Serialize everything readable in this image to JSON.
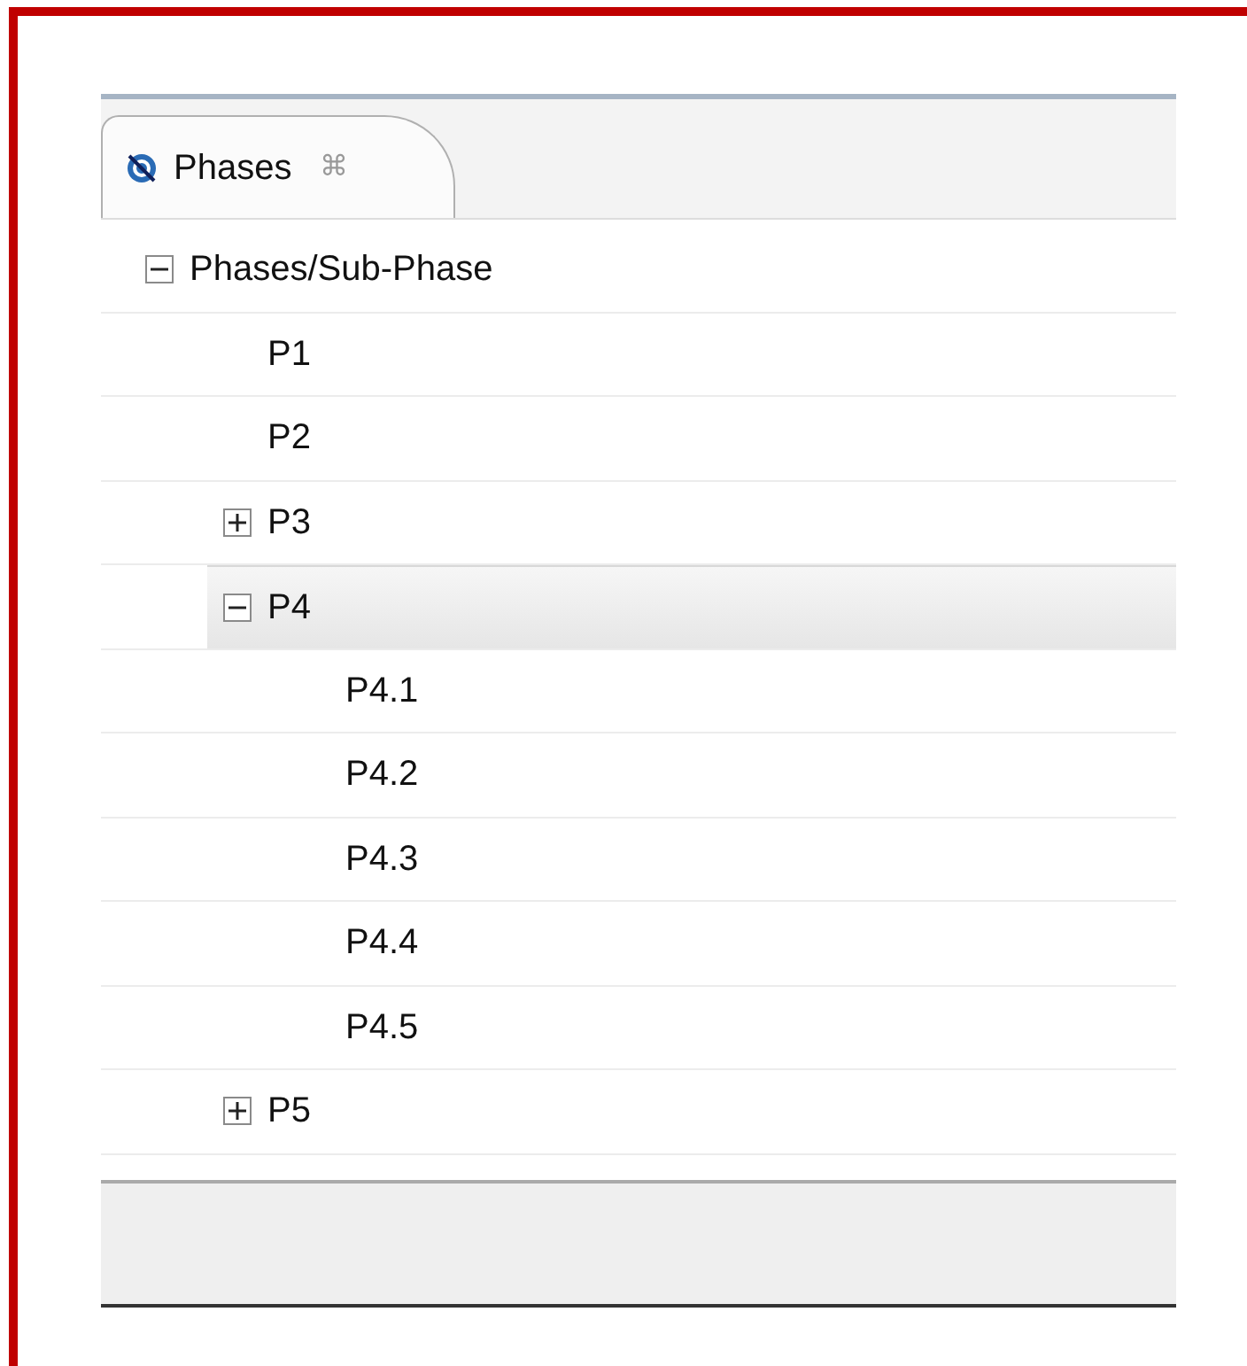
{
  "tabs": [
    {
      "label": "Phases",
      "selected": true,
      "close": "⌘"
    }
  ],
  "tree": [
    {
      "label": "Phases/Sub-Phase",
      "expanded": true,
      "selected": false,
      "children": [
        {
          "label": "P1",
          "selected": false
        },
        {
          "label": "P2",
          "selected": false
        },
        {
          "label": "P3",
          "expanded": false,
          "selected": false
        },
        {
          "label": "P4",
          "expanded": true,
          "selected": true,
          "children": [
            {
              "label": "P4.1",
              "selected": false
            },
            {
              "label": "P4.2",
              "selected": false
            },
            {
              "label": "P4.3",
              "selected": false
            },
            {
              "label": "P4.4",
              "selected": false
            },
            {
              "label": "P4.5",
              "selected": false
            }
          ]
        },
        {
          "label": "P5",
          "expanded": false,
          "selected": false
        }
      ]
    }
  ]
}
